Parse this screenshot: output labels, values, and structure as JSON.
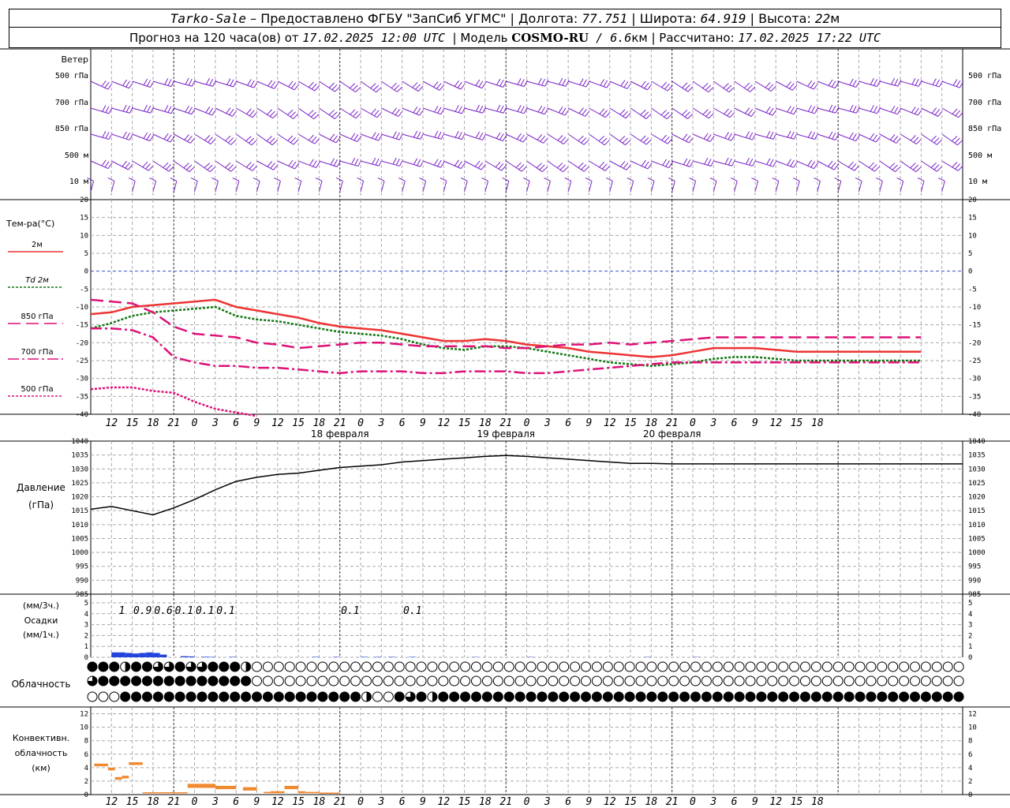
{
  "header": {
    "station": "Tarko-Sale",
    "provider": " – Предоставлено ФГБУ \"ЗапСиб УГМС\" | ",
    "lon_label": "Долгота: ",
    "lon": "77.751",
    "lat_label": " | Широта: ",
    "lat": "64.919",
    "alt_label": " | Высота: ",
    "alt": "22",
    "alt_unit": "м",
    "fc_label": "Прогноз на 120 часа(ов) от ",
    "fc_time": "17.02.2025 12:00 UTC",
    "model_label": "  | Модель ",
    "model": "COSMO-RU",
    "res": " / 6.6",
    "res_unit": "км",
    "calc_label": " | Рассчитано: ",
    "calc_time": "17.02.2025 17:22 UTC"
  },
  "chart_data": [
    {
      "type": "wind-barbs",
      "title": "Ветер",
      "levels": [
        "500 гПа",
        "700 гПа",
        "850 гПа",
        "500 м",
        "10 м"
      ],
      "colors": [
        "#7a20c8",
        "#7a20c8",
        "#7a20c8",
        "#7a20c8",
        "#7a20c8"
      ]
    },
    {
      "type": "line",
      "title": "Тем-ра(°C)",
      "ylim": [
        -40,
        20
      ],
      "yticks": [
        20,
        15,
        10,
        5,
        0,
        -5,
        -10,
        -15,
        -20,
        -25,
        -30,
        -35,
        -40
      ],
      "x": [
        0,
        3,
        6,
        9,
        12,
        15,
        18,
        21,
        24,
        27,
        30,
        33,
        36,
        39,
        42,
        45,
        48,
        51,
        54,
        57,
        60,
        63,
        66,
        69,
        72,
        75,
        78,
        81,
        84,
        87,
        90,
        93,
        96,
        99,
        102,
        105,
        108,
        111,
        114,
        117,
        120
      ],
      "series": [
        {
          "name": "2м",
          "color": "#ee3333",
          "dash": "",
          "width": 2.5,
          "values": [
            -12,
            -11.5,
            -10,
            -9.5,
            -9,
            -8.5,
            -8,
            -10,
            -11,
            -12,
            -13,
            -14.5,
            -15.5,
            -16,
            -16.5,
            -17.5,
            -18.5,
            -19.5,
            -19.5,
            -19,
            -19.5,
            -20.5,
            -21,
            -21.5,
            -22.5,
            -23,
            -23.5,
            -24,
            -23.5,
            -22.5,
            -21.5,
            -21.5,
            -21.5,
            -22,
            -22.5,
            -22.5,
            -22.5,
            -22.5,
            -22.5,
            -22.5,
            -22.5
          ]
        },
        {
          "name": "Td 2м",
          "color": "#117711",
          "dash": "3,2",
          "width": 2.5,
          "values": [
            -16,
            -14.5,
            -12.5,
            -11.5,
            -11,
            -10.5,
            -10,
            -12.5,
            -13.5,
            -14,
            -15,
            -16,
            -17,
            -17.5,
            -18,
            -19,
            -20.5,
            -21.5,
            -22,
            -21,
            -21,
            -21.5,
            -22.5,
            -23.5,
            -24.5,
            -25.5,
            -26,
            -26.5,
            -26,
            -25.5,
            -24.5,
            -24,
            -24,
            -24.5,
            -25,
            -25,
            -25,
            -25,
            -25,
            -25,
            -25
          ]
        },
        {
          "name": "850 гПа",
          "color": "#dd1177",
          "dash": "16,7",
          "width": 2.5,
          "values": [
            -8,
            -8.5,
            -9,
            -11.5,
            -15.5,
            -17.5,
            -18,
            -18.5,
            -20,
            -20.5,
            -21.5,
            -21,
            -20.5,
            -20,
            -20,
            -20.5,
            -21,
            -21,
            -21,
            -21,
            -21.5,
            -21.5,
            -21,
            -20.5,
            -20.5,
            -20,
            -20.5,
            -20,
            -19.5,
            -19,
            -18.5,
            -18.5,
            -18.5,
            -18.5,
            -18.5,
            -18.5,
            -18.5,
            -18.5,
            -18.5,
            -18.5,
            -18.5
          ]
        },
        {
          "name": "700 гПа",
          "color": "#dd1177",
          "dash": "14,4,3,4",
          "width": 2.5,
          "values": [
            -16,
            -16,
            -16.5,
            -18.5,
            -24,
            -25.5,
            -26.5,
            -26.5,
            -27,
            -27,
            -27.5,
            -28,
            -28.5,
            -28,
            -28,
            -28,
            -28.5,
            -28.5,
            -28,
            -28,
            -28,
            -28.5,
            -28.5,
            -28,
            -27.5,
            -27,
            -26.5,
            -26,
            -25.5,
            -25.5,
            -25.5,
            -25.5,
            -25.5,
            -25.5,
            -25.5,
            -25.5,
            -25.5,
            -25.5,
            -25.5,
            -25.5,
            -25.5
          ]
        },
        {
          "name": "500 гПа",
          "color": "#dd1177",
          "dash": "3,2",
          "width": 2.5,
          "values": [
            -33,
            -32.5,
            -32.5,
            -33.5,
            -34,
            -36.5,
            -38.5,
            -39.5,
            -40.5,
            -41,
            null,
            null,
            null,
            null,
            null,
            null,
            null,
            null,
            null,
            null,
            null,
            null,
            null,
            null,
            null,
            null,
            null,
            null,
            null,
            null,
            null,
            null,
            null,
            null,
            null,
            null,
            null,
            null,
            null,
            null,
            null
          ]
        }
      ],
      "xticks": [
        "12",
        "15",
        "18",
        "21",
        "0",
        "3",
        "6",
        "9",
        "12",
        "15",
        "18",
        "21",
        "0",
        "3",
        "6",
        "9",
        "12",
        "15",
        "18",
        "21",
        "0",
        "3",
        "6",
        "9",
        "12",
        "15",
        "18",
        "21",
        "0",
        "3",
        "6",
        "9",
        "12",
        "15",
        "18"
      ],
      "date_labels": [
        "18 февраля",
        "19 февраля",
        "20 февраля"
      ]
    },
    {
      "type": "line",
      "title": "Давление",
      "unit": "(гПа)",
      "ylim": [
        985,
        1040
      ],
      "yticks": [
        1040,
        1035,
        1030,
        1025,
        1020,
        1015,
        1010,
        1005,
        1000,
        995,
        990,
        985
      ],
      "x": [
        0,
        3,
        6,
        9,
        12,
        15,
        18,
        21,
        24,
        27,
        30,
        33,
        36,
        39,
        42,
        45,
        48,
        51,
        54,
        57,
        60,
        63,
        66,
        69,
        72,
        75,
        78,
        81,
        84,
        87,
        90,
        93,
        96
      ],
      "series": [
        {
          "name": "",
          "color": "#000000",
          "values": [
            1015.5,
            1016.5,
            1015,
            1013.5,
            1016,
            1019,
            1022.5,
            1025.5,
            1027,
            1028,
            1028.5,
            1029.5,
            1030.5,
            1031,
            1031.5,
            1032.5,
            1033,
            1033.5,
            1034,
            1034.5,
            1034.8,
            1034.5,
            1034,
            1033.5,
            1033,
            1032.5,
            1032,
            1032,
            1031.8,
            1031.8,
            1031.8,
            1031.8,
            1031.8
          ]
        }
      ]
    },
    {
      "type": "bar",
      "title": "Осадки",
      "unit_3h": "(мм/3ч.)",
      "unit_1h": "(мм/1ч.)",
      "ylim": [
        0,
        5
      ],
      "yticks": [
        5,
        4,
        3,
        2,
        1,
        0
      ],
      "color": "#2244dd",
      "bars": [
        [
          3,
          4,
          0.45
        ],
        [
          4,
          5,
          0.45
        ],
        [
          5,
          6,
          0.4
        ],
        [
          6,
          7,
          0.35
        ],
        [
          7,
          8,
          0.4
        ],
        [
          8,
          9,
          0.45
        ],
        [
          9,
          10,
          0.4
        ],
        [
          10,
          11,
          0.25
        ],
        [
          13,
          14,
          0.1
        ],
        [
          14,
          15,
          0.08
        ],
        [
          16,
          17,
          0.05
        ],
        [
          17,
          18,
          0.04
        ],
        [
          20,
          21,
          0.04
        ],
        [
          32,
          33,
          0.04
        ],
        [
          35,
          36,
          0.04
        ],
        [
          39,
          40,
          0.04
        ],
        [
          41,
          42,
          0.04
        ],
        [
          43,
          44,
          0.04
        ],
        [
          46,
          47,
          0.04
        ],
        [
          55,
          56,
          0.03
        ],
        [
          63,
          64,
          0.03
        ],
        [
          80,
          81,
          0.03
        ],
        [
          87,
          88,
          0.03
        ]
      ],
      "labels_3h": [
        {
          "x": 4.5,
          "text": "1"
        },
        {
          "x": 7.5,
          "text": "0.9"
        },
        {
          "x": 10.5,
          "text": "0.6"
        },
        {
          "x": 13.5,
          "text": "0.1"
        },
        {
          "x": 16.5,
          "text": "0.1"
        },
        {
          "x": 19.5,
          "text": "0.1"
        },
        {
          "x": 37.5,
          "text": "0.1"
        },
        {
          "x": 46.5,
          "text": "0.1"
        }
      ]
    },
    {
      "type": "cloud-symbols",
      "title": "Облачность",
      "rows": [
        "FFFHFFdqFddFFFhOOOOOOOOOOOOOOOOOOOOOOOOOOOOOOOOOOOOOOOOOOOOOOOOOOOOOOOOOOOOOOOOOhOOOOOOOOOO",
        "qFFFFFFFFFFFFFFOOOOOOOOOOOOOOOOOOOOOOOOOOOOOOOOOOOOOOOOOOOOOOOOOOOOOOOOOOOOOOOOOOOOOOOOOOOOOOOOO",
        "OOOFFFFFFFFFFFFFFFFFFFFFFHOOFsFHFFFFFFFFFFFFFFFFFFFFFFFFFFFFFFFFFFFFFFFFFFFFFFFFF"
      ]
    },
    {
      "type": "bar",
      "title": "Конвективн. облачность",
      "unit": "(км)",
      "ylim": [
        0,
        13
      ],
      "yticks": [
        12,
        10,
        8,
        6,
        4,
        2,
        0
      ],
      "color": "#f08a30",
      "bars": [
        [
          0.5,
          2.5,
          4.2,
          4.6
        ],
        [
          2.5,
          3.5,
          3.6,
          4.0
        ],
        [
          3.5,
          4.5,
          2.2,
          2.6
        ],
        [
          4.5,
          5.5,
          2.4,
          2.8
        ],
        [
          5.5,
          7.5,
          4.4,
          4.8
        ],
        [
          7.5,
          14,
          0.2,
          0.35
        ],
        [
          14,
          18,
          1.0,
          1.6
        ],
        [
          18,
          21,
          0.8,
          1.3
        ],
        [
          22,
          24,
          0.6,
          1.1
        ],
        [
          25,
          26,
          0.2,
          0.4
        ],
        [
          26,
          28,
          0.2,
          0.5
        ],
        [
          28,
          30,
          0.8,
          1.3
        ],
        [
          30,
          31,
          0.2,
          0.5
        ],
        [
          31,
          33,
          0.2,
          0.4
        ],
        [
          33,
          36,
          0.15,
          0.3
        ]
      ]
    }
  ]
}
